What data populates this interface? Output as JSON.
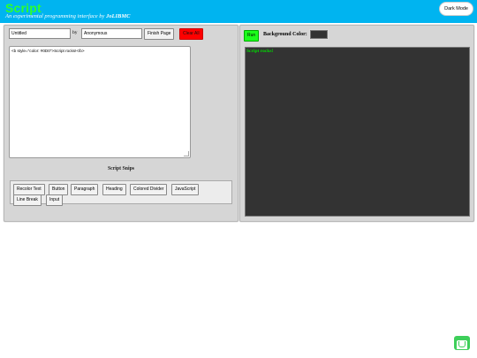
{
  "header": {
    "title": "Script",
    "subtitle_prefix": "An experimental programming interface by ",
    "subtitle_author": "JoLIBMC",
    "dark_mode_label": "Dark Mode"
  },
  "editor_panel": {
    "page_name_value": "Untitled",
    "by_label": "by",
    "author_value": "Anonymous",
    "finish_label": "Finish Page",
    "clear_label": "Clear All",
    "code_value": "<b style=\"color: #0D0\">Script rocks!</b>",
    "snips_title": "Script Snips",
    "snips": [
      "Recolor Text",
      "Button",
      "Paragraph",
      "Heading",
      "Colored Divider",
      "JavaScript",
      "Line Break",
      "Input"
    ]
  },
  "preview_panel": {
    "run_label": "Run",
    "bg_color_label": "Background Color:",
    "bg_color_value": "#333333",
    "output_text": "Script rocks!",
    "output_color": "#00dd00"
  },
  "colors": {
    "header_bg": "#00b4f0",
    "title": "#2dff2d",
    "clear_button": "#ff0000",
    "run_button": "#1bff1b"
  },
  "icons": {
    "corner": "green-badge-icon"
  }
}
